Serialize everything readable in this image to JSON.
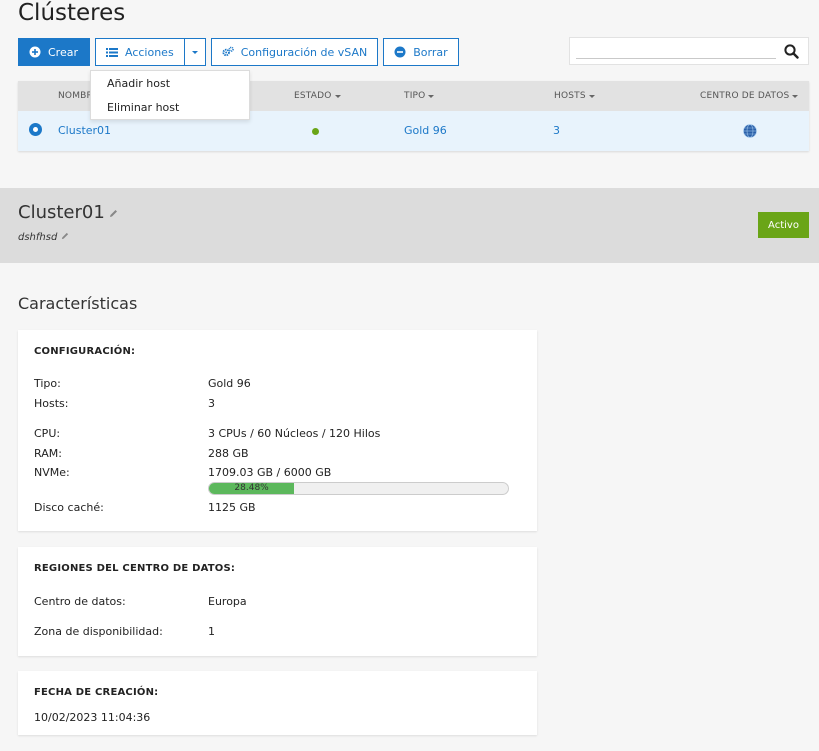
{
  "page_title": "Clústeres",
  "toolbar": {
    "create_label": "Crear",
    "actions_label": "Acciones",
    "vsan_label": "Configuración de vSAN",
    "delete_label": "Borrar"
  },
  "search": {
    "value": "",
    "placeholder": ""
  },
  "actions_menu": {
    "items": [
      "Añadir host",
      "Eliminar host"
    ]
  },
  "table": {
    "columns": [
      "NOMBRE",
      "ESTADO",
      "TIPO",
      "HOSTS",
      "CENTRO DE DATOS"
    ],
    "rows": [
      {
        "name": "Cluster01",
        "status_color": "#6aa517",
        "type": "Gold 96",
        "hosts": "3",
        "datacenter_icon": "globe-icon"
      }
    ]
  },
  "detail": {
    "name": "Cluster01",
    "description": "dshfhsd",
    "status": "Activo",
    "status_color": "#6aa517"
  },
  "features_title": "Características",
  "config": {
    "heading": "CONFIGURACIÓN:",
    "type_label": "Tipo:",
    "type_value": "Gold 96",
    "hosts_label": "Hosts:",
    "hosts_value": "3",
    "cpu_label": "CPU:",
    "cpu_value": "3 CPUs / 60 Núcleos / 120 Hilos",
    "ram_label": "RAM:",
    "ram_value": "288 GB",
    "nvme_label": "NVMe:",
    "nvme_value": "1709.03 GB / 6000 GB",
    "nvme_percent_label": "28.48%",
    "nvme_fraction": 0.2848,
    "cache_label": "Disco caché:",
    "cache_value": "1125 GB"
  },
  "regions": {
    "heading": "REGIONES DEL CENTRO DE DATOS:",
    "dc_label": "Centro de datos:",
    "dc_value": "Europa",
    "az_label": "Zona de disponibilidad:",
    "az_value": "1"
  },
  "created": {
    "heading": "FECHA DE CREACIÓN:",
    "value": "10/02/2023 11:04:36"
  },
  "colors": {
    "accent": "#1c78c8",
    "active": "#6aa517",
    "progress": "#5cb85c"
  }
}
